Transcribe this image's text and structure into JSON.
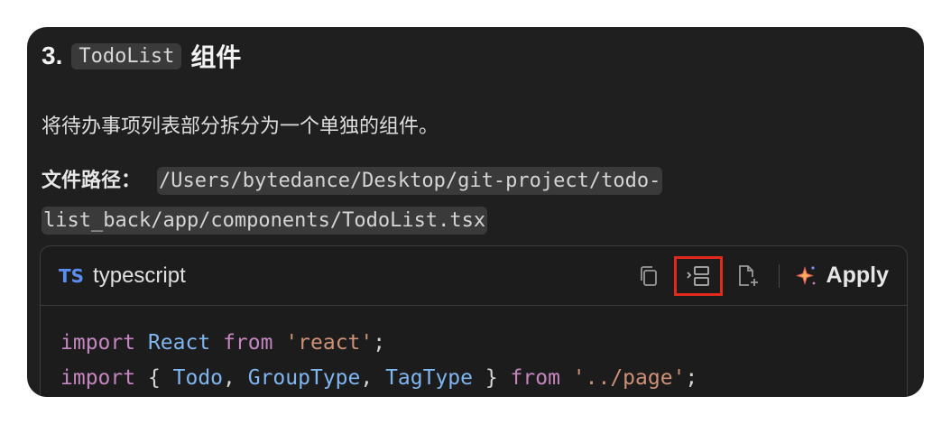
{
  "section": {
    "number": "3.",
    "component_code": "TodoList",
    "suffix": "组件"
  },
  "description": "将待办事项列表部分拆分为一个单独的组件。",
  "file_path": {
    "label": "文件路径：",
    "value": "/Users/bytedance/Desktop/git-project/todo-list_back/app/components/TodoList.tsx"
  },
  "code_block": {
    "lang_badge": "TS",
    "lang_name": "typescript",
    "toolbar": {
      "copy_icon": "copy-icon",
      "insert_icon": "insert-at-cursor-icon",
      "new_file_icon": "new-file-icon",
      "apply_icon": "sparkle-icon",
      "apply_label": "Apply",
      "highlight_color": "#e12a1c"
    },
    "lines": [
      {
        "t1": "import",
        "t2": " ",
        "t3": "React",
        "t4": " ",
        "t5": "from",
        "t6": " ",
        "t7": "'react'",
        "t8": ";"
      },
      {
        "a1": "import",
        "a2": " { ",
        "a3": "Todo",
        "a4": ", ",
        "a5": "GroupType",
        "a6": ", ",
        "a7": "TagType",
        "a8": " } ",
        "a9": "from",
        "a10": " ",
        "a11": "'../page'",
        "a12": ";"
      }
    ]
  },
  "colors": {
    "panel_bg": "#1f1f1f",
    "keyword": "#c586c0",
    "identifier": "#7fb6f0",
    "string": "#ce9178",
    "ts_badge": "#5b8cf0"
  }
}
